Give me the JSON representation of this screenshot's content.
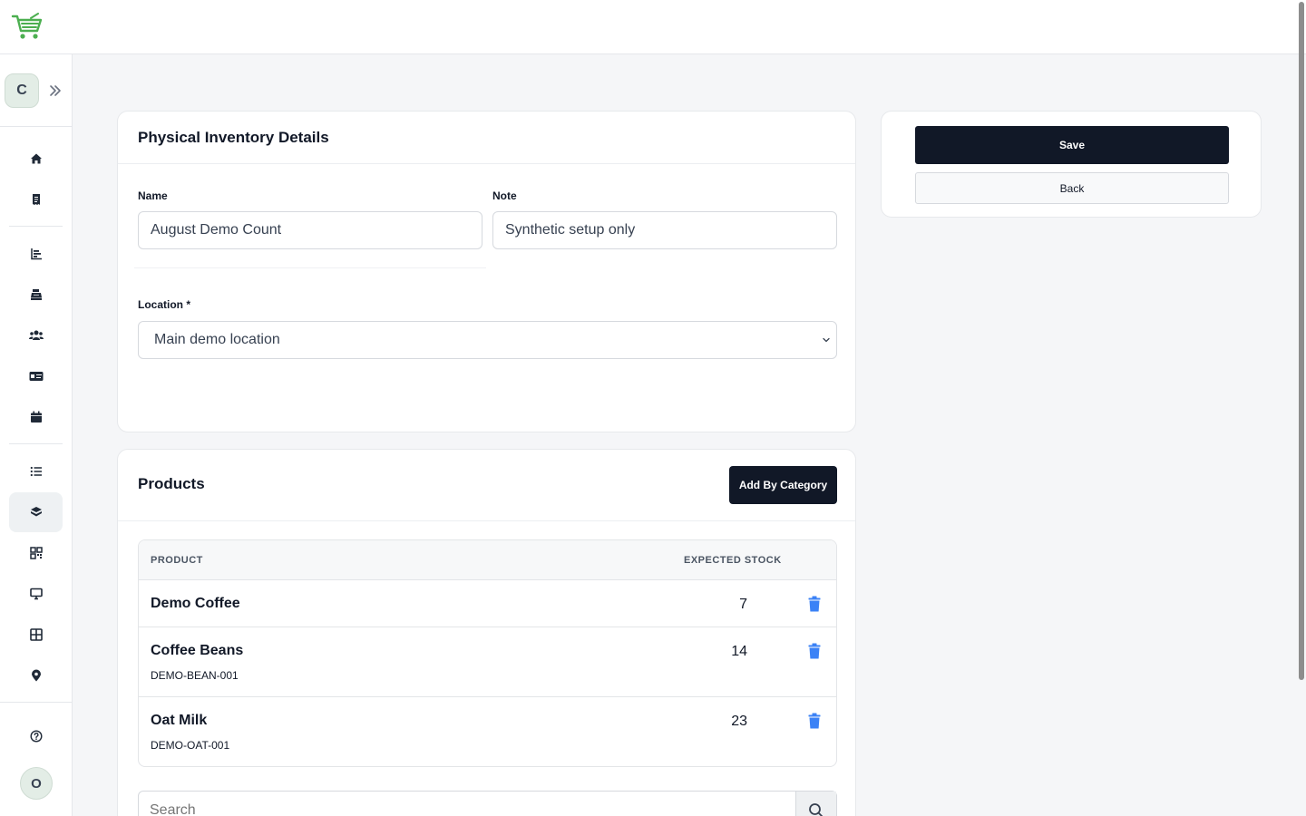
{
  "app": {
    "logo": "cart-logo",
    "org_initial": "C",
    "user_initial": "O"
  },
  "sidebar": {
    "items": [
      {
        "name": "home",
        "icon": "home-icon"
      },
      {
        "name": "receipts",
        "icon": "receipt-icon"
      },
      {
        "name": "reports",
        "icon": "chart-bar-icon"
      },
      {
        "name": "cash-register",
        "icon": "cash-register-icon"
      },
      {
        "name": "customers",
        "icon": "users-icon"
      },
      {
        "name": "cards",
        "icon": "id-card-icon"
      },
      {
        "name": "calendar",
        "icon": "calendar-icon"
      },
      {
        "name": "list",
        "icon": "list-icon"
      },
      {
        "name": "inventory",
        "icon": "boxes-icon",
        "active": true
      },
      {
        "name": "qr",
        "icon": "qr-code-icon"
      },
      {
        "name": "display",
        "icon": "monitor-icon"
      },
      {
        "name": "tables",
        "icon": "grid-icon"
      },
      {
        "name": "locations",
        "icon": "map-pin-icon"
      },
      {
        "name": "help",
        "icon": "help-circle-icon"
      }
    ]
  },
  "details": {
    "title": "Physical Inventory Details",
    "name_label": "Name",
    "name_value": "August Demo Count",
    "note_label": "Note",
    "note_value": "Synthetic setup only",
    "location_label": "Location *",
    "location_value": "Main demo location"
  },
  "actions": {
    "save_label": "Save",
    "back_label": "Back"
  },
  "products": {
    "title": "Products",
    "add_by_category_label": "Add By Category",
    "columns": {
      "product": "PRODUCT",
      "expected_stock": "EXPECTED STOCK"
    },
    "rows": [
      {
        "name": "Demo Coffee",
        "sku": "",
        "stock": "7"
      },
      {
        "name": "Coffee Beans",
        "sku": "DEMO-BEAN-001",
        "stock": "14"
      },
      {
        "name": "Oat Milk",
        "sku": "DEMO-OAT-001",
        "stock": "23"
      }
    ],
    "search_placeholder": "Search"
  },
  "colors": {
    "primary_dark": "#111827",
    "delete_icon": "#3b82f6",
    "logo_green": "#4caf50"
  }
}
